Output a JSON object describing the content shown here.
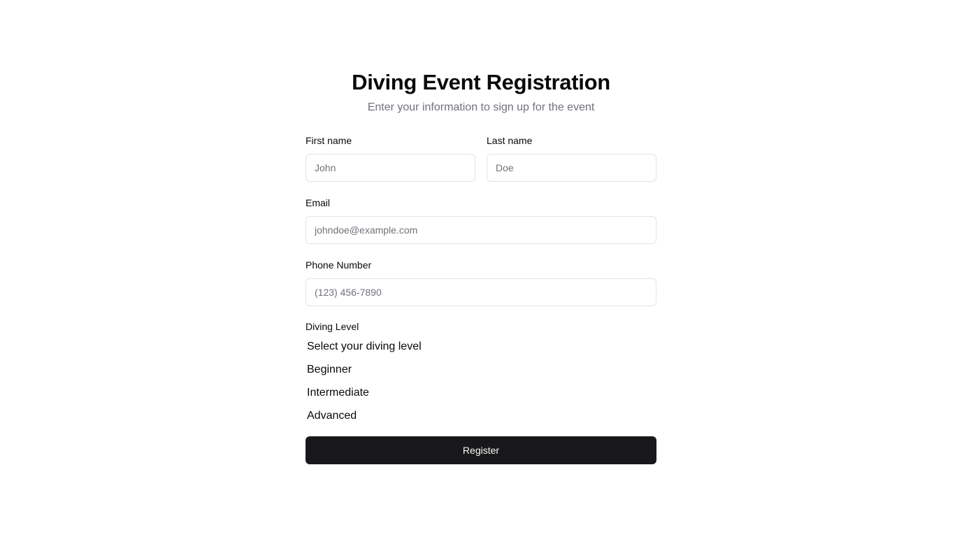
{
  "header": {
    "title": "Diving Event Registration",
    "subtitle": "Enter your information to sign up for the event"
  },
  "form": {
    "first_name": {
      "label": "First name",
      "placeholder": "John",
      "value": ""
    },
    "last_name": {
      "label": "Last name",
      "placeholder": "Doe",
      "value": ""
    },
    "email": {
      "label": "Email",
      "placeholder": "johndoe@example.com",
      "value": ""
    },
    "phone": {
      "label": "Phone Number",
      "placeholder": "(123) 456-7890",
      "value": ""
    },
    "diving_level": {
      "label": "Diving Level",
      "options": [
        "Select your diving level",
        "Beginner",
        "Intermediate",
        "Advanced"
      ]
    },
    "submit_label": "Register"
  },
  "colors": {
    "primary_button_bg": "#18181b",
    "primary_button_text": "#fafafa",
    "muted_text": "#71717a",
    "border": "#e4e4e7"
  }
}
